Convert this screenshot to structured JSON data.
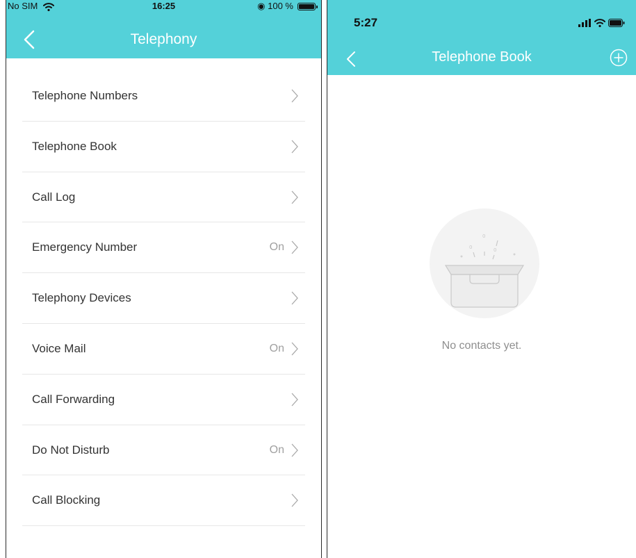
{
  "left": {
    "status": {
      "carrier": "No SIM",
      "time": "16:25",
      "battery": "100 %"
    },
    "nav": {
      "title": "Telephony"
    },
    "items": [
      {
        "label": "Telephone Numbers",
        "value": ""
      },
      {
        "label": "Telephone Book",
        "value": ""
      },
      {
        "label": "Call Log",
        "value": ""
      },
      {
        "label": "Emergency Number",
        "value": "On"
      },
      {
        "label": "Telephony Devices",
        "value": ""
      },
      {
        "label": "Voice Mail",
        "value": "On"
      },
      {
        "label": "Call Forwarding",
        "value": ""
      },
      {
        "label": "Do Not Disturb",
        "value": "On"
      },
      {
        "label": "Call Blocking",
        "value": ""
      }
    ]
  },
  "right": {
    "status": {
      "time": "5:27"
    },
    "nav": {
      "title": "Telephone Book"
    },
    "empty_text": "No contacts yet."
  },
  "colors": {
    "accent": "#54d1d9",
    "divider": "#e7e7e7",
    "muted_text": "#a0a0a0"
  },
  "icons": [
    "back-chevron-icon",
    "wifi-icon",
    "battery-icon",
    "chevron-right-icon",
    "plus-circle-icon",
    "empty-box-icon"
  ]
}
